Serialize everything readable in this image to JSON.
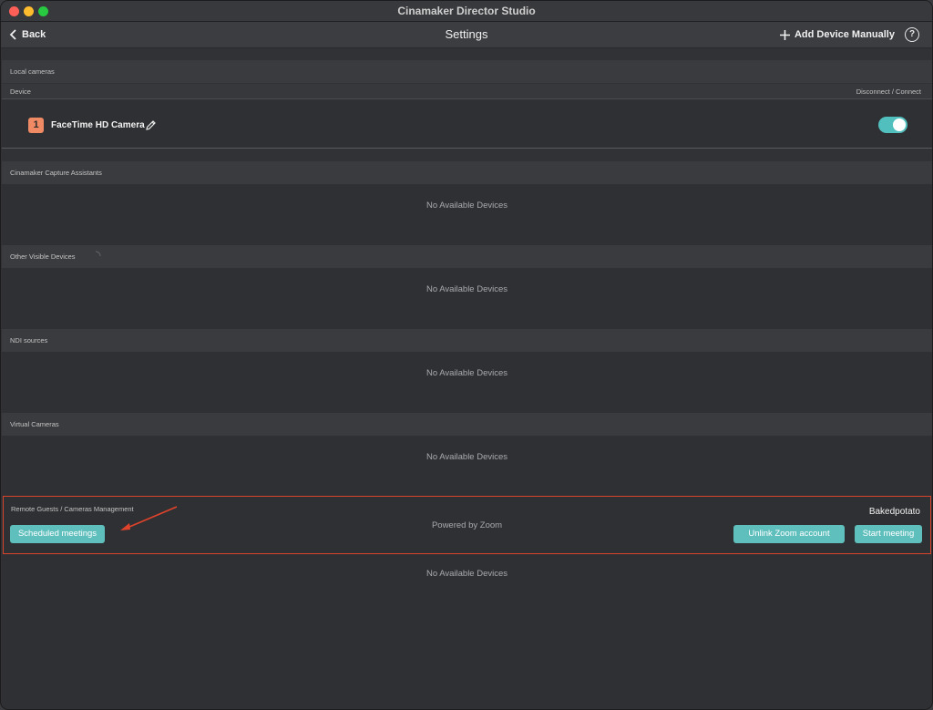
{
  "window": {
    "title": "Cinamaker Director Studio"
  },
  "toolbar": {
    "back_label": "Back",
    "page_title": "Settings",
    "add_device_label": "Add Device Manually",
    "help_label": "?"
  },
  "local_cameras": {
    "title": "Local cameras",
    "col_device": "Device",
    "col_connect": "Disconnect / Connect",
    "devices": [
      {
        "index": "1",
        "name": "FaceTime HD Camera",
        "connected": true
      }
    ]
  },
  "capture_assistants": {
    "title": "Cinamaker Capture Assistants",
    "empty": "No Available Devices"
  },
  "other_devices": {
    "title": "Other Visible Devices",
    "empty": "No Available Devices"
  },
  "ndi_sources": {
    "title": "NDI sources",
    "empty": "No Available Devices"
  },
  "virtual_cameras": {
    "title": "Virtual Cameras",
    "empty": "No Available Devices"
  },
  "remote": {
    "title": "Remote Guests / Cameras Management",
    "scheduled_label": "Scheduled meetings",
    "powered_label": "Powered by Zoom",
    "username": "Bakedpotato",
    "unlink_label": "Unlink Zoom account",
    "start_label": "Start meeting",
    "empty": "No Available Devices"
  },
  "colors": {
    "accent": "#5fbfbd",
    "highlight_border": "#d8432c",
    "badge": "#f08a64"
  }
}
